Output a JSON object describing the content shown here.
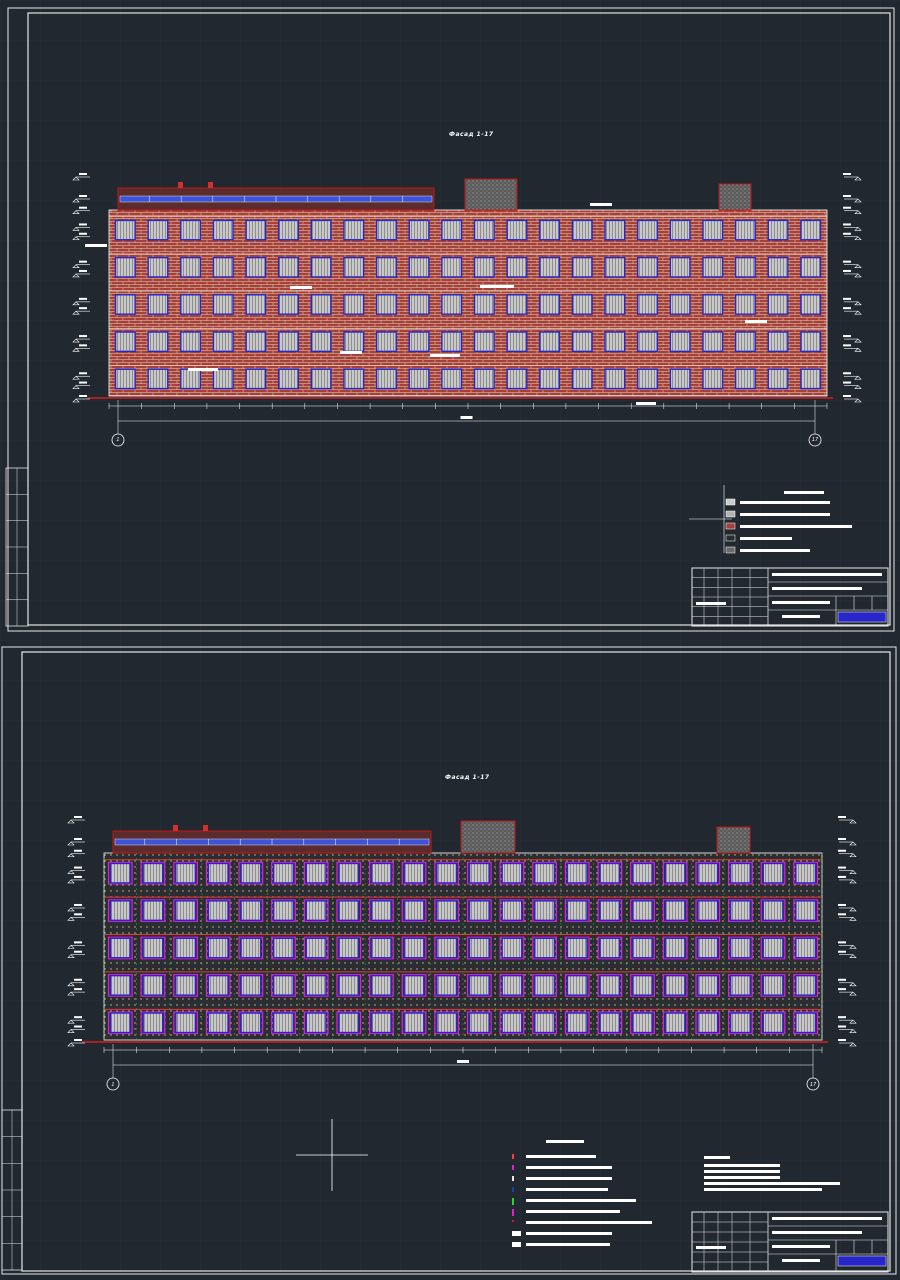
{
  "colors": {
    "background": "#212830",
    "grid": "#2b3340",
    "frame": "#e6e6e6",
    "brick": "#a5413a",
    "brick_mortar": "#e8d3b8",
    "window_frame": "#2727c9",
    "glass": "#b5b5b5",
    "parapet_outline": "#c01818",
    "mech_room_fill": "#6a6a6a",
    "panel_dark": "#262a2f",
    "panel_magenta": "#e020d0",
    "panel_seam": "#33d233",
    "blank_label": "#ffffff"
  },
  "sheets": [
    {
      "id": "sheet-1",
      "title": "Фасад 1-17",
      "axis_start": "1",
      "axis_end": "17",
      "floors": 5,
      "bays": 22,
      "finish": "brick"
    },
    {
      "id": "sheet-2",
      "title": "Фасад 1-17",
      "axis_start": "1",
      "axis_end": "17",
      "floors": 5,
      "bays": 22,
      "finish": "panel"
    }
  ]
}
